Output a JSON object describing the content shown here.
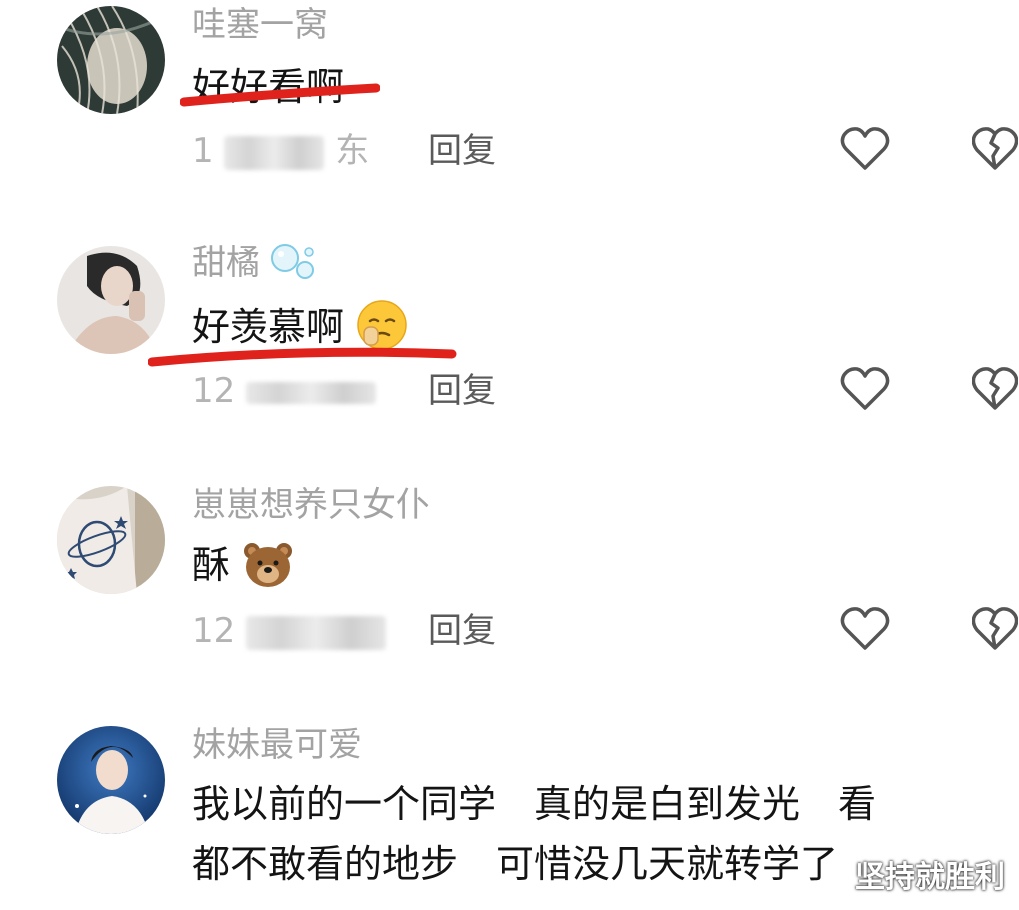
{
  "comments": [
    {
      "username": "哇塞一窝",
      "text": "好好看啊",
      "meta_visible": "1",
      "meta_tail": "东",
      "reply_label": "回复",
      "avatar_icon": "avatar-woman-hair"
    },
    {
      "username": "甜橘",
      "username_icon": "bubbles-icon",
      "text": "好羡慕啊",
      "text_emoji": "crying-face-emoji",
      "meta_visible": "12",
      "reply_label": "回复",
      "avatar_icon": "avatar-woman"
    },
    {
      "username": "崽崽想养只女仆",
      "text": "酥",
      "text_emoji": "bear-emoji",
      "meta_visible": "12",
      "reply_label": "回复",
      "avatar_icon": "avatar-tattoo"
    },
    {
      "username": "妹妹最可爱",
      "text_line1": "我以前的一个同学　真的是白到发光　看",
      "text_line2": "都不敢看的地步　可惜没几天就转学了",
      "avatar_icon": "avatar-man"
    }
  ],
  "watermark": "坚持就胜利",
  "colors": {
    "underline": "#e0221c",
    "username": "#a3a3a3",
    "text": "#141414",
    "icon": "#555555"
  }
}
